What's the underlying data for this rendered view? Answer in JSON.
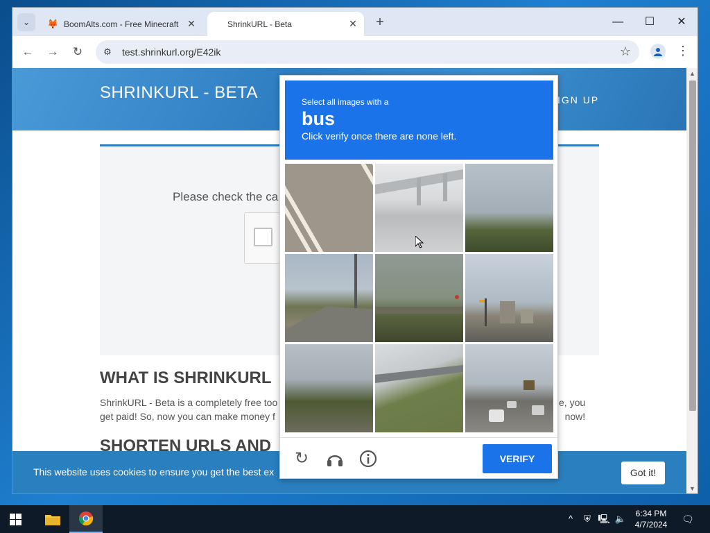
{
  "browser": {
    "tabs": [
      {
        "title": "BoomAlts.com - Free Minecraft",
        "favicon": "fox-icon",
        "active": false
      },
      {
        "title": "ShrinkURL - Beta",
        "active": true
      }
    ],
    "url": "test.shrinkurl.org/E42ik"
  },
  "page": {
    "site_title": "SHRINKURL - BETA",
    "signup_label": "IGN UP",
    "check_prompt": "Please check the ca",
    "what_heading": "WHAT IS SHRINKURL",
    "what_text_line1": "ShrinkURL - Beta is a completely free too",
    "what_text_line2": "get paid! So, now you can make money f",
    "what_text_right1": "e, you",
    "what_text_right2": "now!",
    "shorten_heading": "SHORTEN URLS AND",
    "cookie_text": "This website uses cookies to ensure you get the best ex",
    "cookie_button": "Got it!"
  },
  "captcha": {
    "select_text": "Select all images with a",
    "target": "bus",
    "instruction": "Click verify once there are none left.",
    "verify_label": "VERIFY",
    "tiles": [
      {
        "scene": "road-lines"
      },
      {
        "scene": "highway-overpass"
      },
      {
        "scene": "trees-sky"
      },
      {
        "scene": "road-pole"
      },
      {
        "scene": "bridge-trees"
      },
      {
        "scene": "street-buildings"
      },
      {
        "scene": "trees-field"
      },
      {
        "scene": "overpass-grass"
      },
      {
        "scene": "street-cars"
      }
    ]
  },
  "taskbar": {
    "time": "6:34 PM",
    "date": "4/7/2024"
  },
  "colors": {
    "accent": "#1a73e8",
    "site_blue": "#2d7ac1",
    "cookie_bar": "#2a7fbf"
  }
}
